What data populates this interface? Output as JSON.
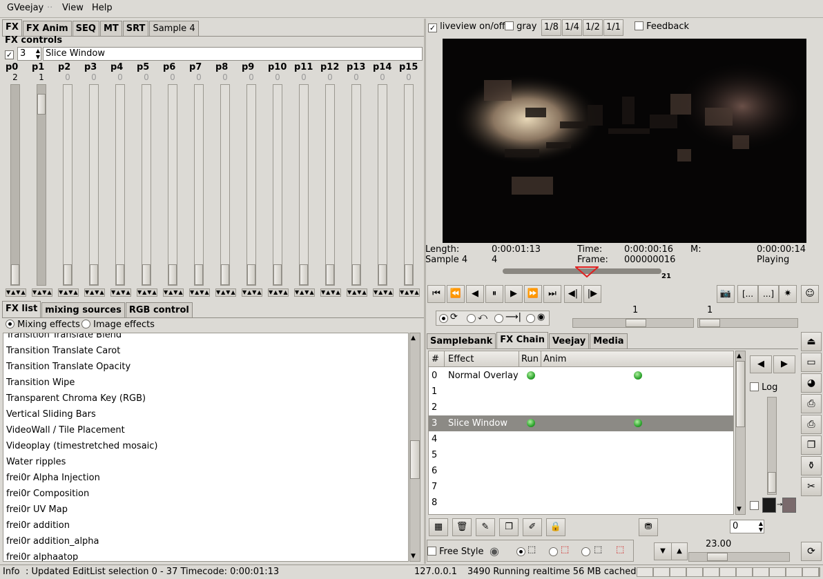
{
  "menu": {
    "items": [
      "GVeejay",
      "View",
      "Help"
    ]
  },
  "left_tabs": [
    "FX",
    "FX Anim",
    "SEQ",
    "MT",
    "SRT",
    "Sample 4"
  ],
  "fx_controls": {
    "title": "FX controls",
    "entry_index": "3",
    "effect_name": "Slice Window",
    "params": [
      {
        "label": "p0",
        "value": "2",
        "level": 0.0
      },
      {
        "label": "p1",
        "value": "1",
        "level": 0.95
      },
      {
        "label": "p2",
        "value": "0",
        "level": 0.0
      },
      {
        "label": "p3",
        "value": "0",
        "level": 0.0
      },
      {
        "label": "p4",
        "value": "0",
        "level": 0.0
      },
      {
        "label": "p5",
        "value": "0",
        "level": 0.0
      },
      {
        "label": "p6",
        "value": "0",
        "level": 0.0
      },
      {
        "label": "p7",
        "value": "0",
        "level": 0.0
      },
      {
        "label": "p8",
        "value": "0",
        "level": 0.0
      },
      {
        "label": "p9",
        "value": "0",
        "level": 0.0
      },
      {
        "label": "p10",
        "value": "0",
        "level": 0.0
      },
      {
        "label": "p11",
        "value": "0",
        "level": 0.0
      },
      {
        "label": "p12",
        "value": "0",
        "level": 0.0
      },
      {
        "label": "p13",
        "value": "0",
        "level": 0.0
      },
      {
        "label": "p14",
        "value": "0",
        "level": 0.0
      },
      {
        "label": "p15",
        "value": "0",
        "level": 0.0
      }
    ]
  },
  "fx_list": {
    "tabs": [
      "FX list",
      "mixing sources",
      "RGB control"
    ],
    "mode_mixing": "Mixing effects",
    "mode_image": "Image effects",
    "items": [
      "Transition Translate Blend",
      "Transition Translate Carot",
      "Transition Translate Opacity",
      "Transition Wipe",
      "Transparent Chroma Key (RGB)",
      "Vertical Sliding Bars",
      "VideoWall / Tile Placement",
      "Videoplay (timestretched mosaic)",
      "Water ripples",
      "frei0r Alpha Injection",
      "frei0r Composition",
      "frei0r UV Map",
      "frei0r addition",
      "frei0r addition_alpha",
      "frei0r alphaatop"
    ]
  },
  "preview": {
    "liveview": "liveview on/off",
    "gray": "gray",
    "scales": [
      "1/8",
      "1/4",
      "1/2",
      "1/1"
    ],
    "feedback": "Feedback"
  },
  "info": {
    "length_label": "Length:",
    "length_value": "0:00:01:13",
    "time_label": "Time:",
    "time_value": "0:00:00:16",
    "m_label": "M:",
    "m_value": "0:00:00:14",
    "sample_label": "Sample 4",
    "sample_value": "4",
    "frame_label": "Frame:",
    "frame_value": "000000016",
    "state": "Playing",
    "marker": "21",
    "timeline_position": 0.42
  },
  "transport": {
    "bracket_left": "[...",
    "bracket_right": "...]",
    "speed_value": "1",
    "slow_value": "1"
  },
  "right_tabs": [
    "Samplebank",
    "FX Chain",
    "Veejay",
    "Media"
  ],
  "fx_chain": {
    "columns": [
      "#",
      "Effect",
      "Run",
      "Anim"
    ],
    "rows": [
      {
        "n": "0",
        "effect": "Normal Overlay"
      },
      {
        "n": "1",
        "effect": ""
      },
      {
        "n": "2",
        "effect": ""
      },
      {
        "n": "3",
        "effect": "Slice Window"
      },
      {
        "n": "4",
        "effect": ""
      },
      {
        "n": "5",
        "effect": ""
      },
      {
        "n": "6",
        "effect": ""
      },
      {
        "n": "7",
        "effect": ""
      },
      {
        "n": "8",
        "effect": ""
      }
    ],
    "log_label": "Log",
    "spin_value": "0"
  },
  "bottom": {
    "free_style": "Free Style",
    "value": "23.00"
  },
  "status": {
    "info_label": "Info",
    "message": ":  Updated EditList selection 0 - 37 Timecode: 0:00:01:13",
    "host": "127.0.0.1",
    "perf": "3490 Running realtime 56 MB cached"
  }
}
